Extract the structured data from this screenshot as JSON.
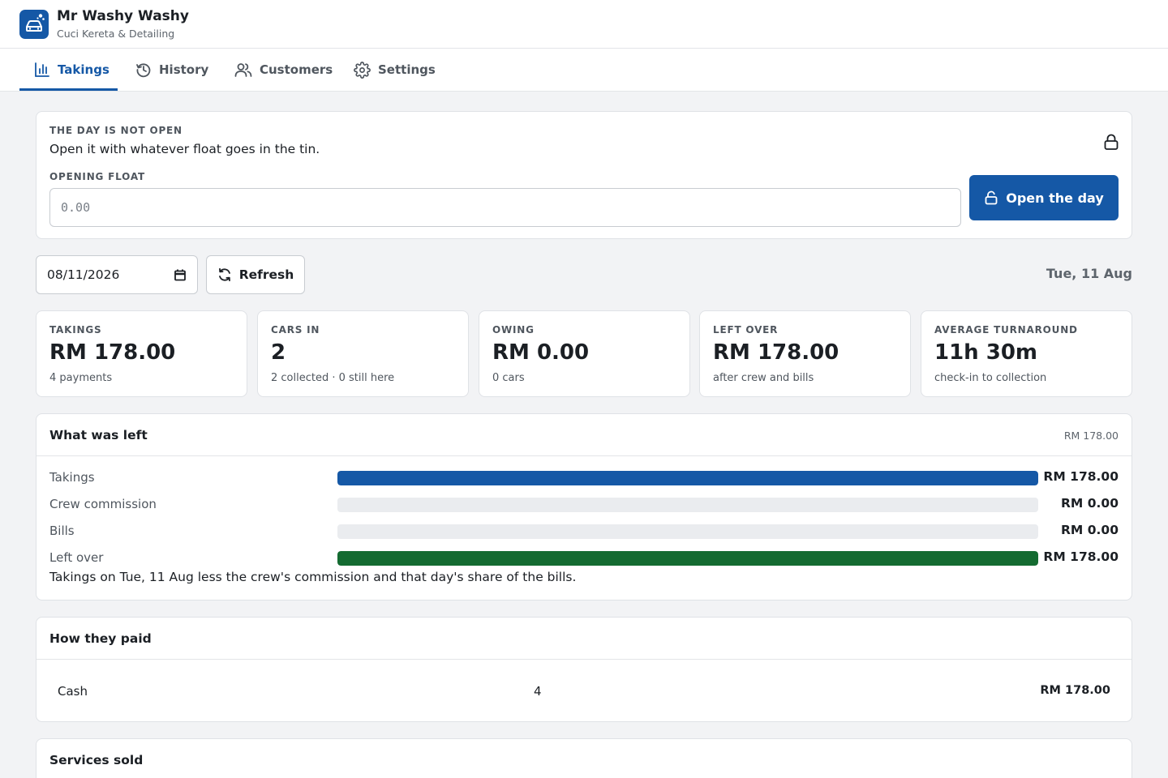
{
  "app": {
    "title": "Mr Washy Washy",
    "subtitle": "Cuci Kereta & Detailing",
    "brand_color": "#1558a6",
    "logo_icon": "car-wash-icon"
  },
  "tabs": [
    {
      "label": "Takings",
      "icon": "bar-chart-icon",
      "active": true
    },
    {
      "label": "History",
      "icon": "history-icon",
      "active": false
    },
    {
      "label": "Customers",
      "icon": "users-icon",
      "active": false
    },
    {
      "label": "Settings",
      "icon": "gear-icon",
      "active": false
    }
  ],
  "open_day": {
    "status": "THE DAY IS NOT OPEN",
    "message": "Open it with whatever float goes in the tin.",
    "float_label": "OPENING FLOAT",
    "float_value": "",
    "float_placeholder": "0.00",
    "button_label": "Open the day"
  },
  "date_bar": {
    "date_value": "08/11/2026",
    "refresh_label": "Refresh",
    "date_display": "Tue, 11 Aug"
  },
  "stats": [
    {
      "label": "TAKINGS",
      "value": "RM 178.00",
      "sub": "4 payments"
    },
    {
      "label": "CARS IN",
      "value": "2",
      "sub": "2 collected · 0 still here"
    },
    {
      "label": "OWING",
      "value": "RM 0.00",
      "sub": "0 cars"
    },
    {
      "label": "LEFT OVER",
      "value": "RM 178.00",
      "sub": "after crew and bills"
    },
    {
      "label": "AVERAGE TURNAROUND",
      "value": "11h 30m",
      "sub": "check-in to collection"
    }
  ],
  "what_was_left": {
    "title": "What was left",
    "total": "RM 178.00",
    "rows": [
      {
        "label": "Takings",
        "amount": "RM 178.00",
        "fraction": 1.0,
        "color": "#1558a6"
      },
      {
        "label": "Crew commission",
        "amount": "RM 0.00",
        "fraction": 0.0,
        "color": "#1558a6"
      },
      {
        "label": "Bills",
        "amount": "RM 0.00",
        "fraction": 0.0,
        "color": "#1558a6"
      },
      {
        "label": "Left over",
        "amount": "RM 178.00",
        "fraction": 1.0,
        "color": "#146b31"
      }
    ],
    "note": "Takings on Tue, 11 Aug less the crew's commission and that day's share of the bills."
  },
  "how_they_paid": {
    "title": "How they paid",
    "rows": [
      {
        "method": "Cash",
        "count": "4",
        "amount": "RM 178.00"
      }
    ]
  },
  "services_sold": {
    "title": "Services sold"
  }
}
